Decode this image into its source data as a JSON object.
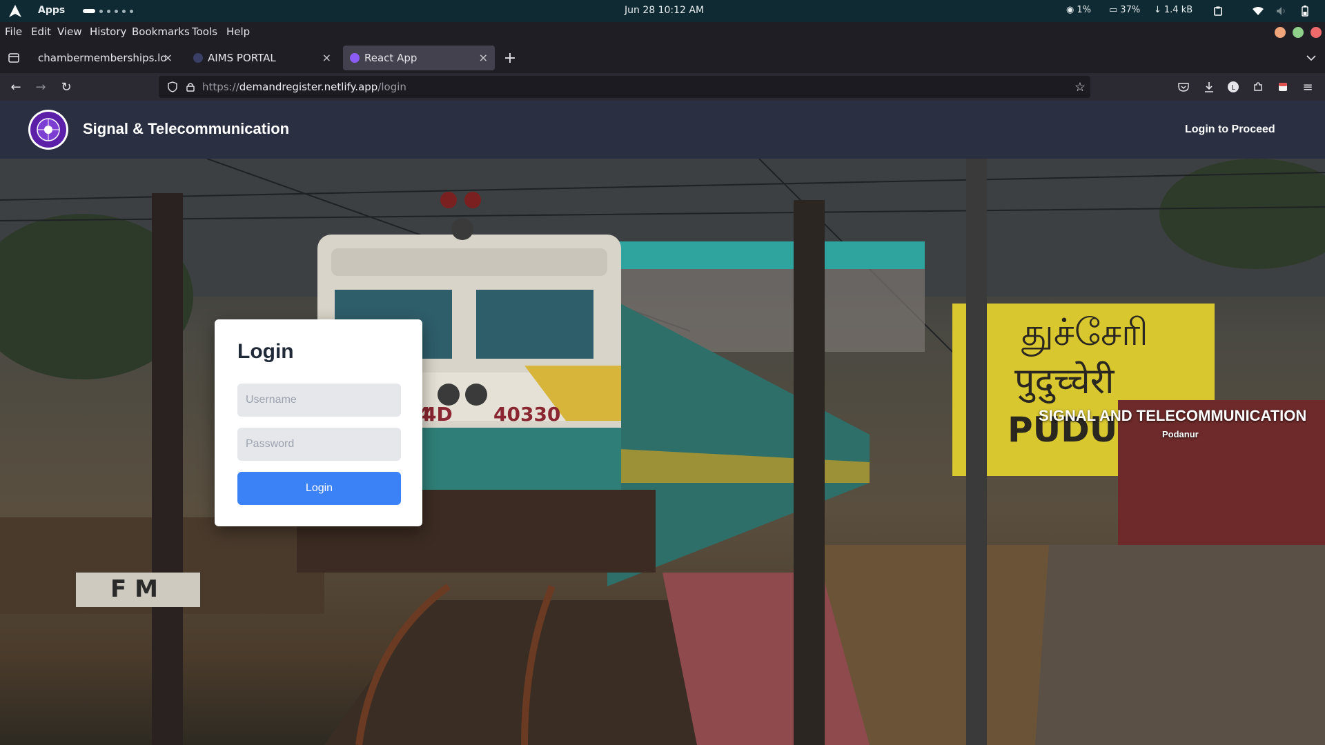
{
  "os": {
    "apps_label": "Apps",
    "clock": "Jun 28  10:12 AM",
    "cpu": "1%",
    "memory": "37%",
    "network": "1.4 kB"
  },
  "browser": {
    "menu": [
      "File",
      "Edit",
      "View",
      "History",
      "Bookmarks",
      "Tools",
      "Help"
    ],
    "tabs": [
      {
        "title": "chambermemberships.lokes"
      },
      {
        "title": "AIMS PORTAL"
      },
      {
        "title": "React App"
      }
    ],
    "url_scheme": "https://",
    "url_host": "demandregister.netlify.app",
    "url_path": "/login"
  },
  "site": {
    "brand": "Signal & Telecommunication",
    "header_action": "Login to Proceed",
    "login": {
      "heading": "Login",
      "username_placeholder": "Username",
      "password_placeholder": "Password",
      "submit_label": "Login"
    },
    "hero_title": "SIGNAL AND TELECOMMUNICATION",
    "hero_subtitle": "Podanur",
    "photo_texts": {
      "loco_number": "40330",
      "loco_prefix": "4D",
      "sign_top": "துச்சேரி",
      "sign_mid": "पुदुच्चेरी",
      "sign_bottom": "PUDUCH",
      "marker": "F M"
    }
  },
  "colors": {
    "accent": "#3b82f6",
    "header_bg": "#2a3041"
  }
}
